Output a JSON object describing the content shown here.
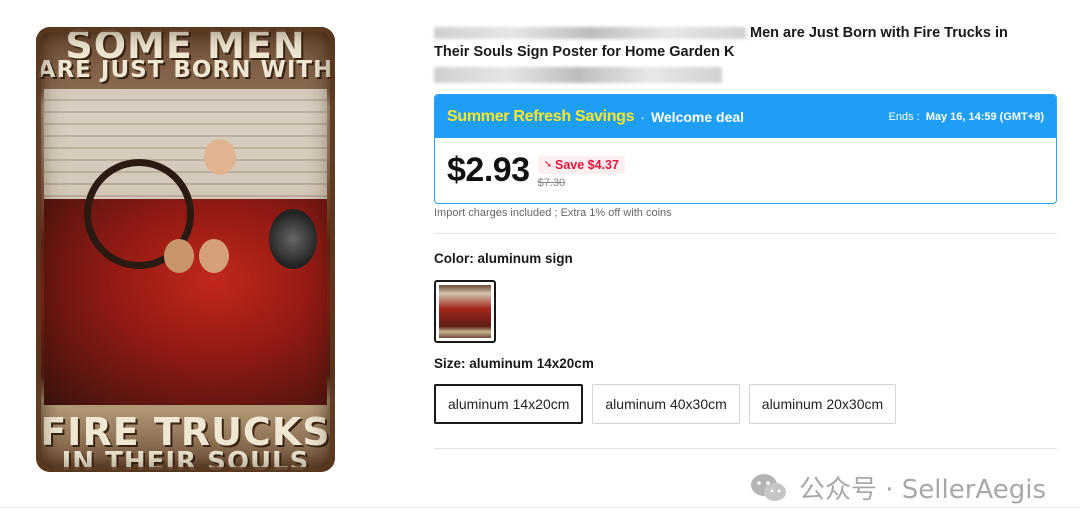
{
  "product": {
    "image_alt": "",
    "poster_lines": [
      "SOME MEN",
      "ARE JUST BORN WITH",
      "FIRE TRUCKS",
      "IN THEIR SOULS"
    ]
  },
  "title": {
    "visible_text": "Men are Just Born with Fire Trucks in Their Souls Sign Poster for Home Garden K"
  },
  "deal": {
    "name": "Summer Refresh Savings",
    "separator": "·",
    "subtitle": "Welcome deal",
    "ends_label": "Ends :",
    "ends_value": "May 16, 14:59 (GMT+8)",
    "price": "$2.93",
    "save": "Save $4.37",
    "original_price": "$7.30",
    "bar_color": "#1e9ef4",
    "name_color": "#ffe827"
  },
  "import_note": "Import charges included ; Extra 1% off with coins",
  "color": {
    "label": "Color: aluminum sign"
  },
  "size": {
    "label": "Size: aluminum 14x20cm",
    "options": [
      "aluminum 14x20cm",
      "aluminum 40x30cm",
      "aluminum 20x30cm"
    ],
    "selected_index": 0
  },
  "watermark": {
    "text": "公众号 · SellerAegis"
  }
}
